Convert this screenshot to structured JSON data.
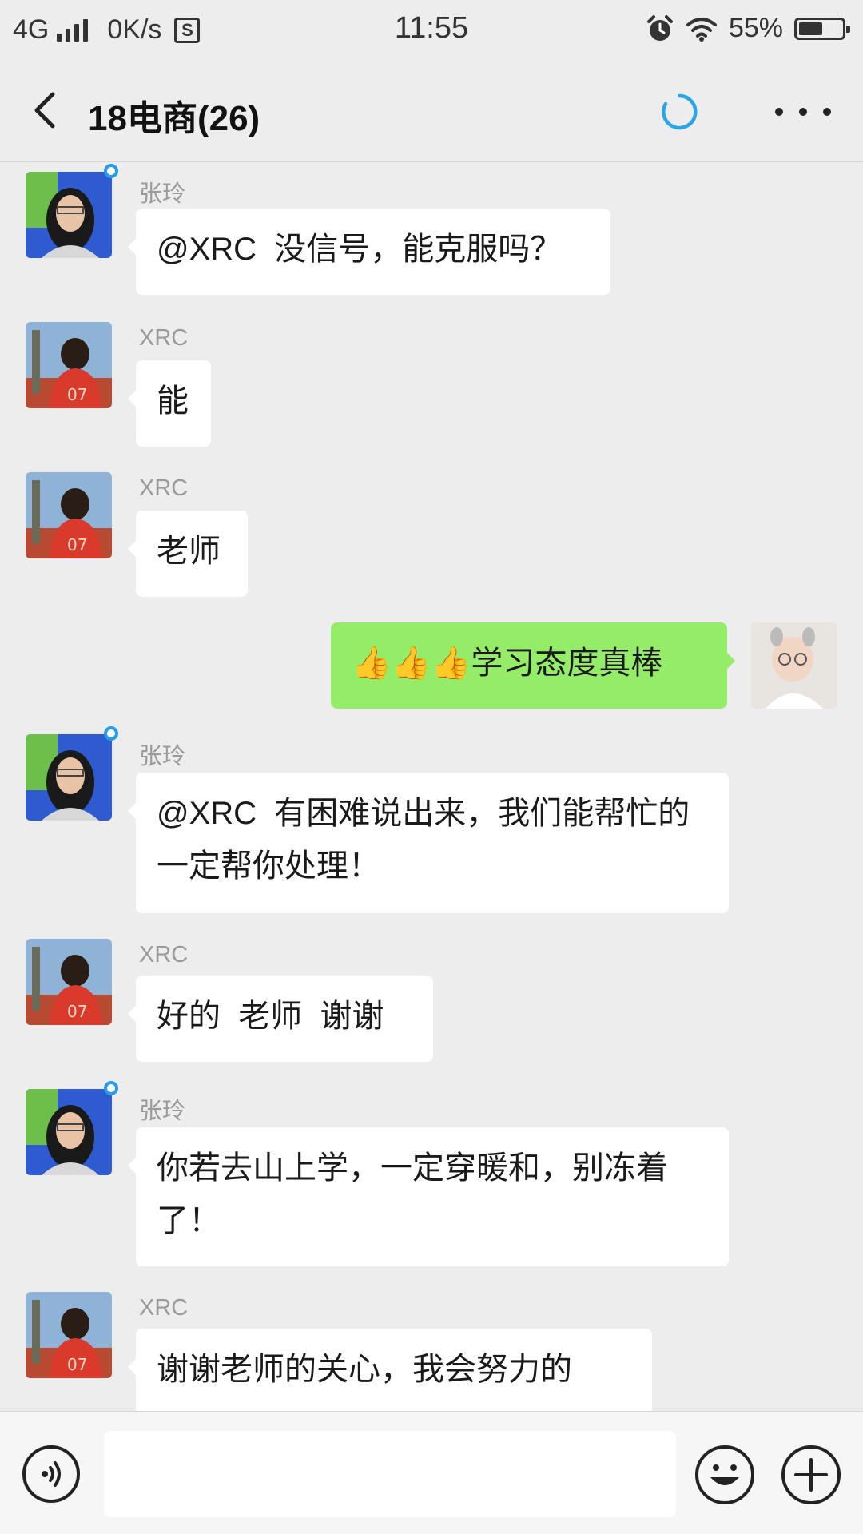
{
  "status_bar": {
    "network": "4G",
    "speed": "0K/s",
    "s_icon": "S",
    "time": "11:55",
    "battery": "55%",
    "battery_level": 0.55,
    "icons": [
      "signal-icon",
      "sim-s-icon",
      "alarm-icon",
      "wifi-icon",
      "battery-icon"
    ]
  },
  "header": {
    "title": "18电商(26)",
    "icons": [
      "back-icon",
      "loading-icon",
      "more-icon"
    ]
  },
  "messages": [
    {
      "sender": "张玲",
      "text": "@XRC  没信号，能克服吗？",
      "side": "left",
      "avatar": "zhangling-avatar"
    },
    {
      "sender": "XRC",
      "text": "能",
      "side": "left",
      "avatar": "xrc-avatar"
    },
    {
      "sender": "XRC",
      "text": "老师",
      "side": "left",
      "avatar": "xrc-avatar"
    },
    {
      "sender": "",
      "text": "👍👍👍学习态度真棒",
      "side": "right",
      "avatar": "self-avatar"
    },
    {
      "sender": "张玲",
      "text": "@XRC  有困难说出来，我们能帮忙的一定帮你处理！",
      "side": "left",
      "avatar": "zhangling-avatar"
    },
    {
      "sender": "XRC",
      "text": "好的  老师  谢谢",
      "side": "left",
      "avatar": "xrc-avatar"
    },
    {
      "sender": "张玲",
      "text": "你若去山上学，一定穿暖和，别冻着了！",
      "side": "left",
      "avatar": "zhangling-avatar"
    },
    {
      "sender": "XRC",
      "text": "谢谢老师的关心，我会努力的",
      "side": "left",
      "avatar": "xrc-avatar"
    }
  ],
  "input": {
    "value": "",
    "icons": [
      "voice-icon",
      "emoji-icon",
      "plus-icon"
    ]
  },
  "colors": {
    "background": "#ededed",
    "self_bubble": "#95ec69",
    "other_bubble": "#ffffff",
    "online_dot": "#2a9be8",
    "loading": "#2aa6e8"
  }
}
